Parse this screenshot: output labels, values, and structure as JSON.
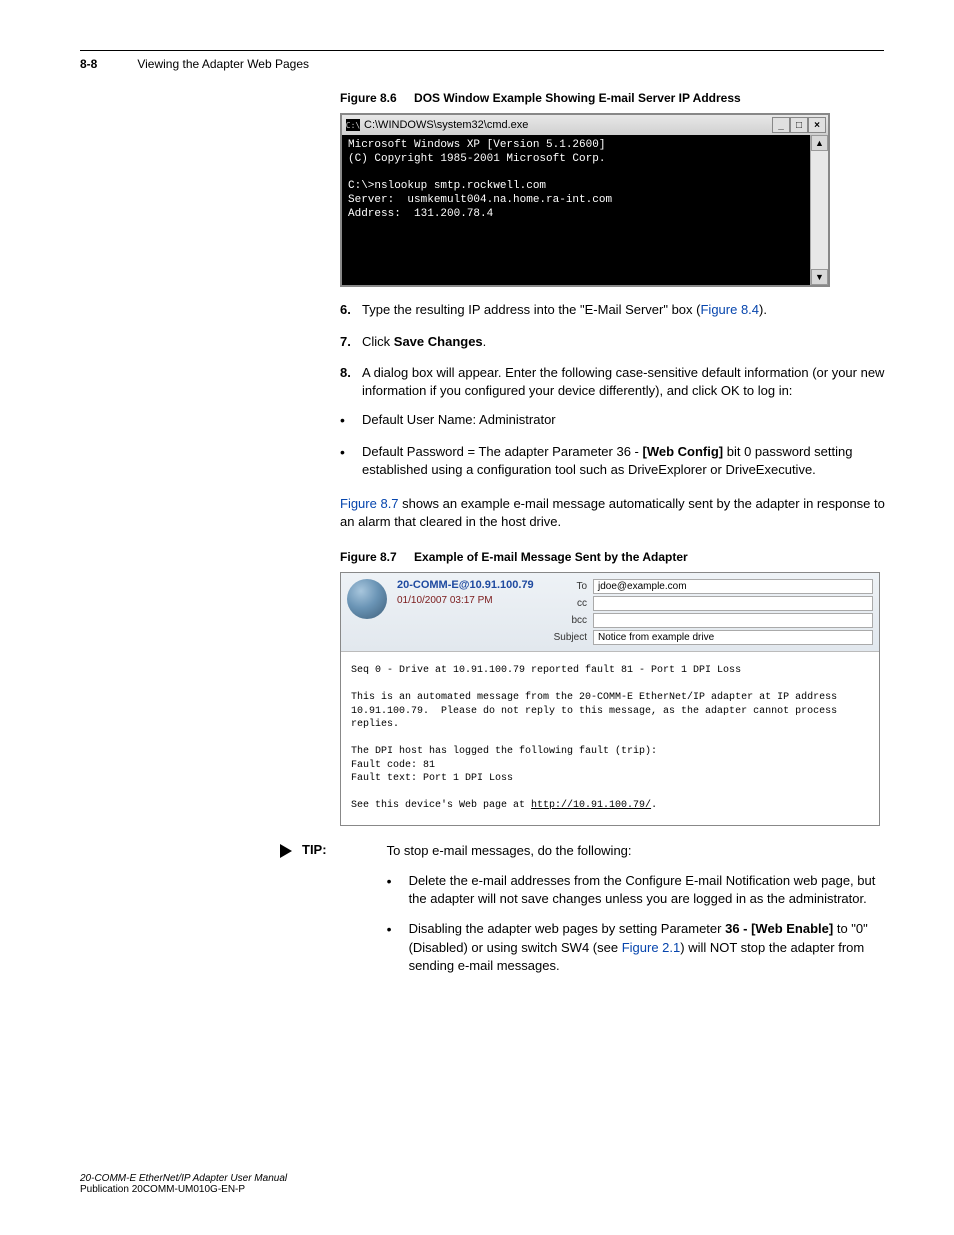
{
  "header": {
    "page_number": "8-8",
    "chapter_title": "Viewing the Adapter Web Pages"
  },
  "figure_dos": {
    "label": "Figure 8.6",
    "title": "DOS Window Example Showing E-mail Server IP Address",
    "window_title": "C:\\WINDOWS\\system32\\cmd.exe",
    "icon_text": "C:\\",
    "text": "Microsoft Windows XP [Version 5.1.2600]\n(C) Copyright 1985-2001 Microsoft Corp.\n\nC:\\>nslookup smtp.rockwell.com\nServer:  usmkemult004.na.home.ra-int.com\nAddress:  131.200.78.4"
  },
  "step6": {
    "num": "6.",
    "text_pre": "Type the resulting IP address into the \"E-Mail Server\" box (",
    "link": "Figure 8.4",
    "text_post": ")."
  },
  "step7": {
    "num": "7.",
    "text": "Click Save Changes."
  },
  "step8": {
    "num": "8.",
    "text": "A dialog box will appear. Enter the following case-sensitive default information (or your new information if you configured your device differently), and click OK to log in:"
  },
  "creds": {
    "bullet1": "Default User Name: Administrator",
    "bullet2_pre": "Default Password = The adapter Parameter 36 - ",
    "bullet2_bold": "[Web Config]",
    "bullet2_post": " bit 0 password setting established using a configuration tool such as DriveExplorer or DriveExecutive."
  },
  "figure_email": {
    "link": "Figure 8.7",
    "intro": " shows an example e-mail message automatically sent by the adapter in response to an alarm that cleared in the host drive.",
    "label": "Figure 8.7",
    "title": "Example of E-mail Message Sent by the Adapter",
    "from": "20-COMM-E@10.91.100.79",
    "date": "01/10/2007 03:17 PM",
    "to_label": "To",
    "to_value": "jdoe@example.com",
    "cc_label": "cc",
    "cc_value": "",
    "bcc_label": "bcc",
    "bcc_value": "",
    "subject_label": "Subject",
    "subject_value": "Notice from example drive",
    "body_line1": "Seq 0 - Drive at 10.91.100.79 reported fault 81 - Port 1 DPI Loss",
    "body_line2": "This is an automated message from the 20-COMM-E EtherNet/IP adapter at IP address 10.91.100.79.  Please do not reply to this message, as the adapter cannot process replies.",
    "body_line3": "The DPI host has logged the following fault (trip):",
    "body_line4": "Fault code: 81",
    "body_line5": "Fault text: Port 1 DPI Loss",
    "body_line6_pre": "See this device's Web page at ",
    "body_link": "http://10.91.100.79/",
    "body_line6_post": "."
  },
  "tip": {
    "label": "TIP:",
    "intro": "To stop e-mail messages, do the following:",
    "bullet1": "Delete the e-mail addresses from the Configure E-mail Notification web page, but the adapter will not save changes unless you are logged in as the administrator.",
    "bullet2_pre": "Disabling the adapter web pages by setting Parameter ",
    "bullet2_bold": "36 - [Web Enable]",
    "bullet2_post_pre": " to \"0\" (Disabled) or using switch SW4 (see ",
    "bullet2_link": "Figure 2.1",
    "bullet2_post": ") will NOT stop the adapter from sending e-mail messages."
  },
  "footer": {
    "title": "20-COMM-E EtherNet/IP Adapter User Manual",
    "pub": "Publication 20COMM-UM010G-EN-P"
  }
}
